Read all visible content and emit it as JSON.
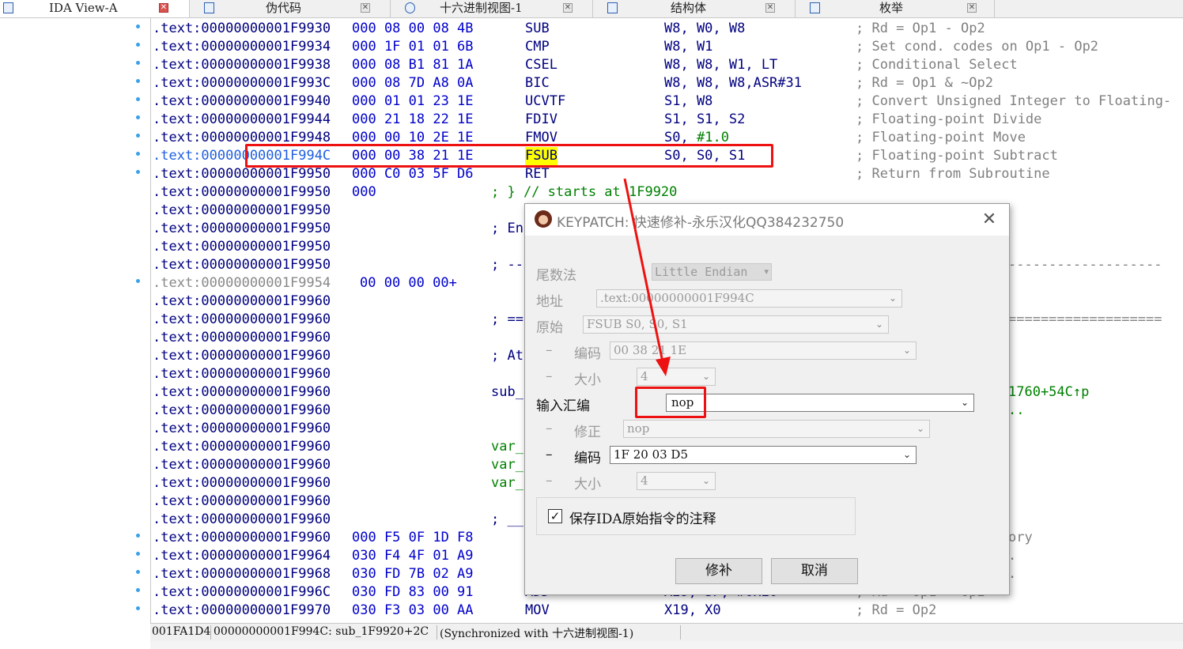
{
  "tabs": [
    {
      "label": "IDA View-A",
      "active": true
    },
    {
      "label": "伪代码",
      "active": false
    },
    {
      "label": "十六进制视图-1",
      "active": false
    },
    {
      "label": "结构体",
      "active": false
    },
    {
      "label": "枚举",
      "active": false
    }
  ],
  "code": {
    "rows": [
      {
        "addr": ".text:00000000001F9930",
        "bytes": "000 08 00 08 4B",
        "mnem": "SUB",
        "ops": "W8, W0, W8",
        "comment": "; Rd = Op1 - Op2"
      },
      {
        "addr": ".text:00000000001F9934",
        "bytes": "000 1F 01 01 6B",
        "mnem": "CMP",
        "ops": "W8, W1",
        "comment": "; Set cond. codes on Op1 - Op2"
      },
      {
        "addr": ".text:00000000001F9938",
        "bytes": "000 08 B1 81 1A",
        "mnem": "CSEL",
        "ops": "W8, W8, W1, LT",
        "comment": "; Conditional Select"
      },
      {
        "addr": ".text:00000000001F993C",
        "bytes": "000 08 7D A8 0A",
        "mnem": "BIC",
        "ops": "W8, W8, W8,ASR#31",
        "comment": "; Rd = Op1 & ~Op2"
      },
      {
        "addr": ".text:00000000001F9940",
        "bytes": "000 01 01 23 1E",
        "mnem": "UCVTF",
        "ops": "S1, W8",
        "comment": "; Convert Unsigned Integer to Floating-"
      },
      {
        "addr": ".text:00000000001F9944",
        "bytes": "000 21 18 22 1E",
        "mnem": "FDIV",
        "ops": "S1, S1, S2",
        "comment": "; Floating-point Divide"
      },
      {
        "addr": ".text:00000000001F9948",
        "bytes": "000 00 10 2E 1E",
        "mnem": "FMOV",
        "ops": "S0, ",
        "ops_num": "#1.0",
        "comment": "; Floating-point Move"
      },
      {
        "addr": ".text:00000000001F994C",
        "bytes": "000 00 38 21 1E",
        "mnem": "FSUB",
        "ops": "S0, S0, S1",
        "comment": "; Floating-point Subtract",
        "current": true
      },
      {
        "addr": ".text:00000000001F9950",
        "bytes": "000 C0 03 5F D6",
        "mnem": "RET",
        "ops": "",
        "comment": "; Return from Subroutine"
      },
      {
        "addr": ".text:00000000001F9950",
        "bytes": "000",
        "mid": "; } // starts at 1F9920"
      },
      {
        "addr": ".text:00000000001F9950",
        "mid": ""
      },
      {
        "addr": ".text:00000000001F9950",
        "mid": "; En"
      },
      {
        "addr": ".text:00000000001F9950",
        "mid": ""
      },
      {
        "addr": ".text:00000000001F9950",
        "mid": "; --",
        "right": "-------------------"
      },
      {
        "addr": ".text:00000000001F9954",
        "bytes": "00 00 00 00+",
        "grey": true
      },
      {
        "addr": ".text:00000000001F9960",
        "mid": ""
      },
      {
        "addr": ".text:00000000001F9960",
        "mid": "; ==",
        "right": "==================="
      },
      {
        "addr": ".text:00000000001F9960",
        "mid": ""
      },
      {
        "addr": ".text:00000000001F9960",
        "mid": "; At"
      },
      {
        "addr": ".text:00000000001F9960",
        "mid": ""
      },
      {
        "addr": ".text:00000000001F9960",
        "mid": "sub_",
        "right": "1760+54C↑p",
        "right_green": true
      },
      {
        "addr": ".text:00000000001F9960",
        "mid": "",
        "right": "..",
        "right_green": true
      },
      {
        "addr": ".text:00000000001F9960",
        "mid": ""
      },
      {
        "addr": ".text:00000000001F9960",
        "mid": "var_",
        "mid_green": true
      },
      {
        "addr": ".text:00000000001F9960",
        "mid": "var_",
        "mid_green": true
      },
      {
        "addr": ".text:00000000001F9960",
        "mid": "var_",
        "mid_green": true
      },
      {
        "addr": ".text:00000000001F9960",
        "mid": ""
      },
      {
        "addr": ".text:00000000001F9960",
        "mid": "; __"
      },
      {
        "addr": ".text:00000000001F9960",
        "bytes": "000 F5 0F 1D F8",
        "right": "ory"
      },
      {
        "addr": ".text:00000000001F9964",
        "bytes": "030 F4 4F 01 A9",
        "right": "."
      },
      {
        "addr": ".text:00000000001F9968",
        "bytes": "030 FD 7B 02 A9",
        "right": "."
      },
      {
        "addr": ".text:00000000001F996C",
        "bytes": "030 FD 83 00 91",
        "mnem": "ADD",
        "ops": "X29, SP, #0x20",
        "comment": "; Rd = Op1 + Op2"
      },
      {
        "addr": ".text:00000000001F9970",
        "bytes": "030 F3 03 00 AA",
        "mnem": "MOV",
        "ops": "X19, X0",
        "comment": "; Rd = Op2"
      }
    ]
  },
  "status": {
    "offset": "001FA1D4",
    "location": "00000000001F994C: sub_1F9920+2C",
    "sync": "(Synchronized with 十六进制视图-1)"
  },
  "dialog": {
    "title": "KEYPATCH: 快速修补-永乐汉化QQ384232750",
    "endian_label": "尾数法",
    "endian_value": "Little Endian",
    "address_label": "地址",
    "address_value": ".text:00000000001F994C",
    "original_label": "原始",
    "original_value": "FSUB S0, S0, S1",
    "orig_encoding_label": "编码",
    "orig_encoding_value": "00 38 21 1E",
    "orig_size_label": "大小",
    "orig_size_value": "4",
    "input_label": "输入汇编",
    "input_value": "nop",
    "fixup_label": "修正",
    "fixup_value": "nop",
    "new_encoding_label": "编码",
    "new_encoding_value": "1F 20 03 D5",
    "new_size_label": "大小",
    "new_size_value": "4",
    "dash": "–",
    "keep_comment_label": "保存IDA原始指令的注释",
    "keep_comment_checked": true,
    "patch_button": "修补",
    "cancel_button": "取消"
  },
  "colors": {
    "annotation_red": "#ee1111",
    "highlight_yellow": "#ffff00",
    "address_blue": "#000080",
    "bytes_blue": "#0000cc",
    "comment_grey": "#808080",
    "number_green": "#008000"
  }
}
